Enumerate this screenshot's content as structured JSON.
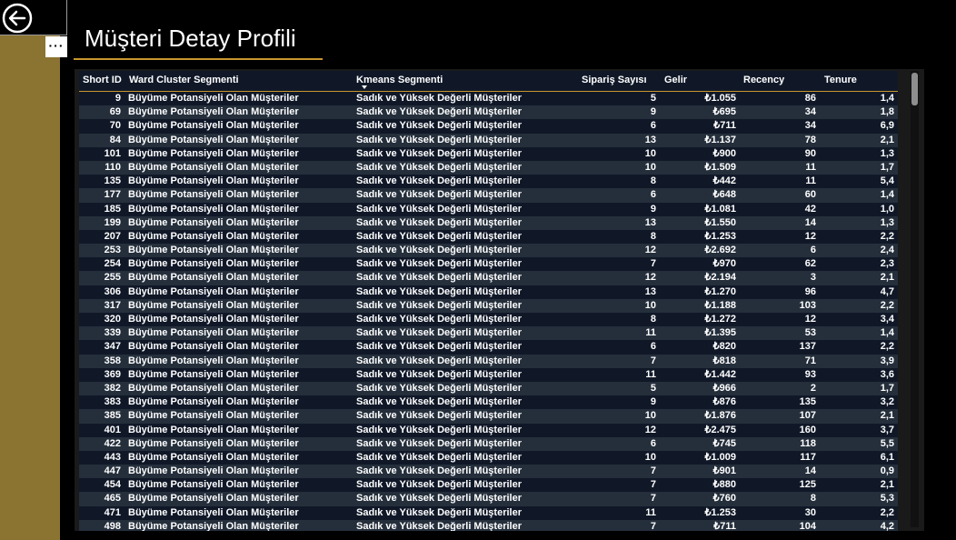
{
  "page": {
    "title": "Müşteri Detay Profili"
  },
  "toolbar": {
    "more_label": "···"
  },
  "table": {
    "columns": [
      "Short ID",
      "Ward Cluster Segmenti",
      "Kmeans Segmenti",
      "Sipariş Sayısı",
      "Gelir",
      "Recency",
      "Tenure"
    ],
    "sorted_column": "Kmeans Segmenti",
    "rows": [
      [
        "9",
        "Büyüme Potansiyeli Olan Müşteriler",
        "Sadık ve Yüksek Değerli Müşteriler",
        "5",
        "₺1.055",
        "86",
        "1,4"
      ],
      [
        "69",
        "Büyüme Potansiyeli Olan Müşteriler",
        "Sadık ve Yüksek Değerli Müşteriler",
        "9",
        "₺695",
        "34",
        "1,8"
      ],
      [
        "70",
        "Büyüme Potansiyeli Olan Müşteriler",
        "Sadık ve Yüksek Değerli Müşteriler",
        "6",
        "₺711",
        "34",
        "6,9"
      ],
      [
        "84",
        "Büyüme Potansiyeli Olan Müşteriler",
        "Sadık ve Yüksek Değerli Müşteriler",
        "13",
        "₺1.137",
        "78",
        "2,1"
      ],
      [
        "101",
        "Büyüme Potansiyeli Olan Müşteriler",
        "Sadık ve Yüksek Değerli Müşteriler",
        "10",
        "₺900",
        "90",
        "1,3"
      ],
      [
        "110",
        "Büyüme Potansiyeli Olan Müşteriler",
        "Sadık ve Yüksek Değerli Müşteriler",
        "10",
        "₺1.509",
        "11",
        "1,7"
      ],
      [
        "135",
        "Büyüme Potansiyeli Olan Müşteriler",
        "Sadık ve Yüksek Değerli Müşteriler",
        "8",
        "₺442",
        "11",
        "5,4"
      ],
      [
        "177",
        "Büyüme Potansiyeli Olan Müşteriler",
        "Sadık ve Yüksek Değerli Müşteriler",
        "6",
        "₺648",
        "60",
        "1,4"
      ],
      [
        "185",
        "Büyüme Potansiyeli Olan Müşteriler",
        "Sadık ve Yüksek Değerli Müşteriler",
        "9",
        "₺1.081",
        "42",
        "1,0"
      ],
      [
        "199",
        "Büyüme Potansiyeli Olan Müşteriler",
        "Sadık ve Yüksek Değerli Müşteriler",
        "13",
        "₺1.550",
        "14",
        "1,3"
      ],
      [
        "207",
        "Büyüme Potansiyeli Olan Müşteriler",
        "Sadık ve Yüksek Değerli Müşteriler",
        "8",
        "₺1.253",
        "12",
        "2,2"
      ],
      [
        "253",
        "Büyüme Potansiyeli Olan Müşteriler",
        "Sadık ve Yüksek Değerli Müşteriler",
        "12",
        "₺2.692",
        "6",
        "2,4"
      ],
      [
        "254",
        "Büyüme Potansiyeli Olan Müşteriler",
        "Sadık ve Yüksek Değerli Müşteriler",
        "7",
        "₺970",
        "62",
        "2,3"
      ],
      [
        "255",
        "Büyüme Potansiyeli Olan Müşteriler",
        "Sadık ve Yüksek Değerli Müşteriler",
        "12",
        "₺2.194",
        "3",
        "2,1"
      ],
      [
        "306",
        "Büyüme Potansiyeli Olan Müşteriler",
        "Sadık ve Yüksek Değerli Müşteriler",
        "13",
        "₺1.270",
        "96",
        "4,7"
      ],
      [
        "317",
        "Büyüme Potansiyeli Olan Müşteriler",
        "Sadık ve Yüksek Değerli Müşteriler",
        "10",
        "₺1.188",
        "103",
        "2,2"
      ],
      [
        "320",
        "Büyüme Potansiyeli Olan Müşteriler",
        "Sadık ve Yüksek Değerli Müşteriler",
        "8",
        "₺1.272",
        "12",
        "3,4"
      ],
      [
        "339",
        "Büyüme Potansiyeli Olan Müşteriler",
        "Sadık ve Yüksek Değerli Müşteriler",
        "11",
        "₺1.395",
        "53",
        "1,4"
      ],
      [
        "347",
        "Büyüme Potansiyeli Olan Müşteriler",
        "Sadık ve Yüksek Değerli Müşteriler",
        "6",
        "₺820",
        "137",
        "2,2"
      ],
      [
        "358",
        "Büyüme Potansiyeli Olan Müşteriler",
        "Sadık ve Yüksek Değerli Müşteriler",
        "7",
        "₺818",
        "71",
        "3,9"
      ],
      [
        "369",
        "Büyüme Potansiyeli Olan Müşteriler",
        "Sadık ve Yüksek Değerli Müşteriler",
        "11",
        "₺1.442",
        "93",
        "3,6"
      ],
      [
        "382",
        "Büyüme Potansiyeli Olan Müşteriler",
        "Sadık ve Yüksek Değerli Müşteriler",
        "5",
        "₺966",
        "2",
        "1,7"
      ],
      [
        "383",
        "Büyüme Potansiyeli Olan Müşteriler",
        "Sadık ve Yüksek Değerli Müşteriler",
        "9",
        "₺876",
        "135",
        "3,2"
      ],
      [
        "385",
        "Büyüme Potansiyeli Olan Müşteriler",
        "Sadık ve Yüksek Değerli Müşteriler",
        "10",
        "₺1.876",
        "107",
        "2,1"
      ],
      [
        "401",
        "Büyüme Potansiyeli Olan Müşteriler",
        "Sadık ve Yüksek Değerli Müşteriler",
        "12",
        "₺2.475",
        "160",
        "3,7"
      ],
      [
        "422",
        "Büyüme Potansiyeli Olan Müşteriler",
        "Sadık ve Yüksek Değerli Müşteriler",
        "6",
        "₺745",
        "118",
        "5,5"
      ],
      [
        "443",
        "Büyüme Potansiyeli Olan Müşteriler",
        "Sadık ve Yüksek Değerli Müşteriler",
        "10",
        "₺1.009",
        "117",
        "6,1"
      ],
      [
        "447",
        "Büyüme Potansiyeli Olan Müşteriler",
        "Sadık ve Yüksek Değerli Müşteriler",
        "7",
        "₺901",
        "14",
        "0,9"
      ],
      [
        "454",
        "Büyüme Potansiyeli Olan Müşteriler",
        "Sadık ve Yüksek Değerli Müşteriler",
        "7",
        "₺880",
        "125",
        "2,1"
      ],
      [
        "465",
        "Büyüme Potansiyeli Olan Müşteriler",
        "Sadık ve Yüksek Değerli Müşteriler",
        "7",
        "₺760",
        "8",
        "5,3"
      ],
      [
        "471",
        "Büyüme Potansiyeli Olan Müşteriler",
        "Sadık ve Yüksek Değerli Müşteriler",
        "11",
        "₺1.253",
        "30",
        "2,2"
      ],
      [
        "498",
        "Büyüme Potansiyeli Olan Müşteriler",
        "Sadık ve Yüksek Değerli Müşteriler",
        "7",
        "₺711",
        "104",
        "4,2"
      ]
    ]
  },
  "colors": {
    "accent": "#c8962c",
    "side_strip": "#8b7331",
    "row_dark": "#101828",
    "row_light": "#252f3c"
  },
  "icons": {
    "back": "back-arrow-circle-icon",
    "sort": "sort-descending-icon",
    "more": "more-options-icon"
  }
}
